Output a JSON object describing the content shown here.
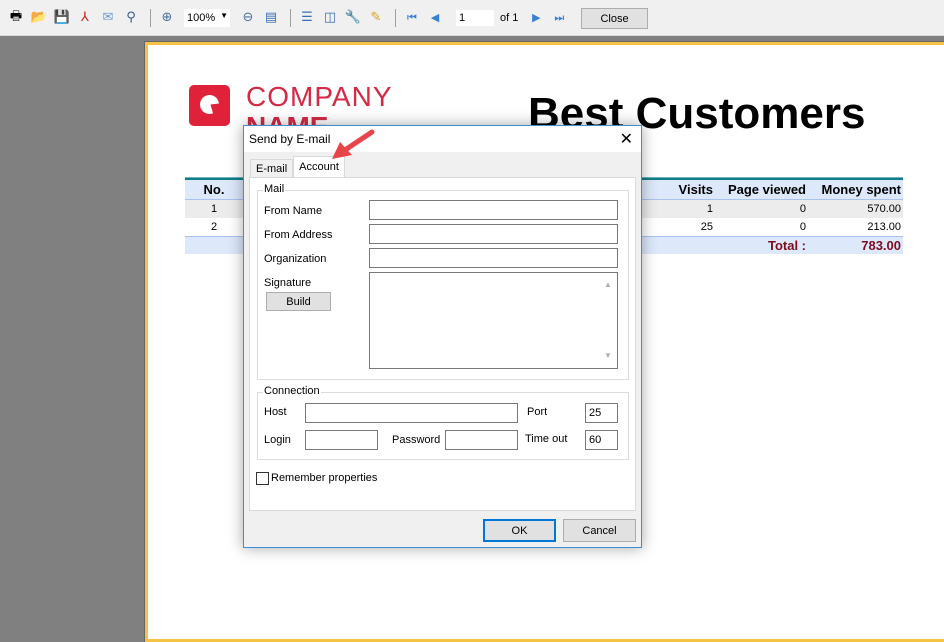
{
  "toolbar": {
    "icons": [
      "print-icon",
      "open-icon",
      "save-icon",
      "pdf-icon",
      "email-icon",
      "find-icon",
      "zoom-in-icon",
      "zoom-out-icon",
      "full-screen-icon",
      "outline-icon",
      "thumbnails-icon",
      "settings-icon",
      "edit-icon",
      "first-page-icon",
      "prev-page-icon",
      "next-page-icon",
      "last-page-icon"
    ],
    "zoom_value": "100%",
    "page_value": "1",
    "page_of": "of 1",
    "close_label": "Close"
  },
  "report": {
    "company_line1": "COMPANY",
    "company_line2": "NAME",
    "title": "Best Customers",
    "columns": {
      "no": "No.",
      "visits": "Visits",
      "page_viewed": "Page viewed",
      "money_spent": "Money spent"
    },
    "rows": [
      {
        "no": "1",
        "visits": "1",
        "page_viewed": "0",
        "money_spent": "570.00"
      },
      {
        "no": "2",
        "visits": "25",
        "page_viewed": "0",
        "money_spent": "213.00"
      }
    ],
    "total_label": "Total :",
    "total_value": "783.00"
  },
  "dialog": {
    "title": "Send by E-mail",
    "tabs": [
      "E-mail",
      "Account"
    ],
    "active_tab": "Account",
    "mail_group": "Mail",
    "from_name_label": "From Name",
    "from_name_value": "",
    "from_address_label": "From Address",
    "from_address_value": "",
    "organization_label": "Organization",
    "organization_value": "",
    "signature_label": "Signature",
    "build_label": "Build",
    "connection_group": "Connection",
    "host_label": "Host",
    "host_value": "",
    "port_label": "Port",
    "port_value": "25",
    "login_label": "Login",
    "login_value": "",
    "password_label": "Password",
    "password_value": "",
    "timeout_label": "Time out",
    "timeout_value": "60",
    "remember_label": "Remember properties",
    "remember_checked": false,
    "ok_label": "OK",
    "cancel_label": "Cancel"
  },
  "colors": {
    "brand": "#e0213a",
    "accent": "#0078d7",
    "total": "#7a0f1c",
    "page_border": "#f5c343",
    "annotation_arrow": "#e8454b"
  }
}
